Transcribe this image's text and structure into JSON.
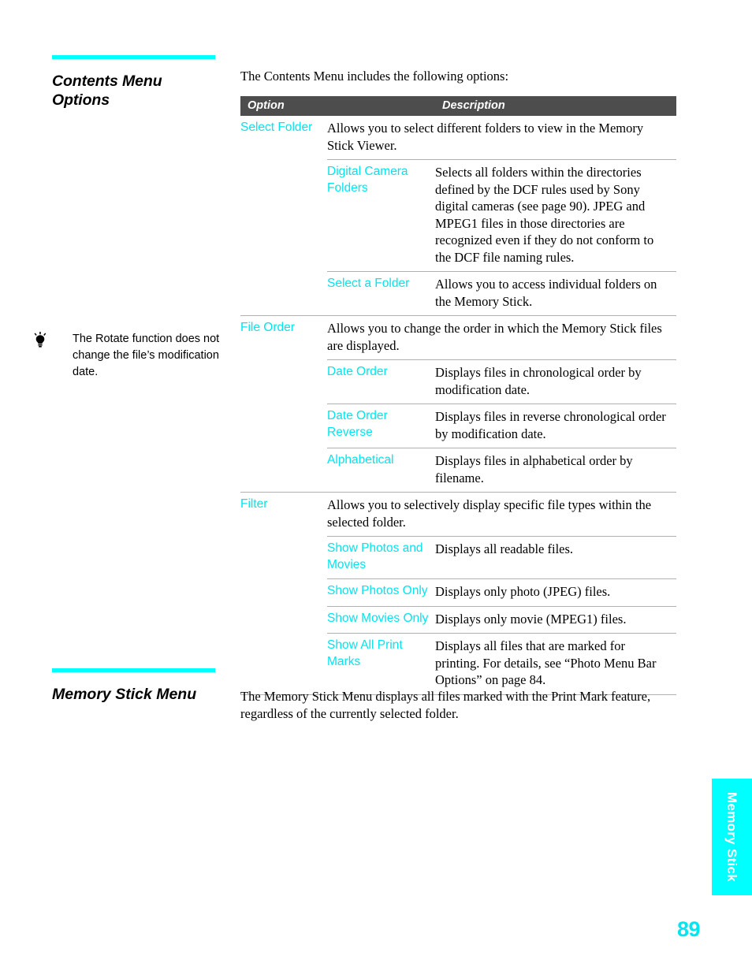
{
  "page": {
    "number": "89",
    "accent_cyan": "#00ffff",
    "link_cyan": "#00e5f0",
    "header_bar_gray": "#4d4d4d"
  },
  "side_tab": {
    "label": "Memory Stick"
  },
  "section1": {
    "title_line1": "Contents Menu",
    "title_line2": "Options",
    "intro": "The Contents Menu includes the following options:"
  },
  "tip": {
    "icon": "lightbulb-tip-icon",
    "text": "The Rotate function does not change the file’s modification date."
  },
  "table": {
    "headers": {
      "option": "Option",
      "description": "Description"
    },
    "rows": [
      {
        "level": 1,
        "option": "Select Folder",
        "description": "Allows you to select different folders to view in the Memory Stick Viewer."
      },
      {
        "level": 2,
        "option": "Digital Camera Folders",
        "description": "Selects all folders within the directories defined by the DCF rules used by Sony digital cameras (see page 90). JPEG and MPEG1 files in those directories are recognized even if they do not conform to the DCF file naming rules."
      },
      {
        "level": 2,
        "option": "Select a Folder",
        "description": "Allows you to access individual folders on the Memory Stick."
      },
      {
        "level": 1,
        "option": "File Order",
        "description": "Allows you to change the order in which the Memory Stick files are displayed."
      },
      {
        "level": 2,
        "option": "Date Order",
        "description": "Displays files in chronological order by modification date."
      },
      {
        "level": 2,
        "option": "Date Order Reverse",
        "description": "Displays files in reverse chronological order by modification date."
      },
      {
        "level": 2,
        "option": "Alphabetical",
        "description": "Displays files in alphabetical order by filename."
      },
      {
        "level": 1,
        "option": "Filter",
        "description": "Allows you to selectively display specific file types within the selected folder."
      },
      {
        "level": 2,
        "option": "Show Photos and Movies",
        "description": "Displays all readable files."
      },
      {
        "level": 2,
        "option": "Show Photos Only",
        "description": "Displays only photo (JPEG) files."
      },
      {
        "level": 2,
        "option": "Show Movies Only",
        "description": "Displays only movie (MPEG1) files."
      },
      {
        "level": 2,
        "option": "Show All Print Marks",
        "description": "Displays all files that are marked for printing. For details, see “Photo Menu Bar Options” on page 84."
      }
    ]
  },
  "section2": {
    "title": "Memory Stick Menu",
    "body": "The Memory Stick Menu displays all files marked with the Print Mark feature, regardless of the currently selected folder."
  }
}
